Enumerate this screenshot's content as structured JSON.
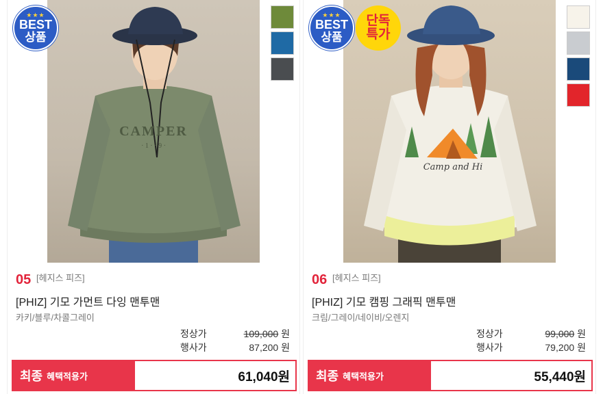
{
  "products": [
    {
      "badges": {
        "best_top": "BEST",
        "best_bottom": "상품",
        "stars": "★★★",
        "exclusive_top": "",
        "exclusive_bottom": ""
      },
      "swatches": [
        "#6e8a3a",
        "#1f6aa5",
        "#4a4d50"
      ],
      "rank": "05",
      "brand": "[헤지스 피즈]",
      "title": "[PHIZ] 기모 가먼트 다잉 맨투맨",
      "colors": "카키/블루/차콜그레이",
      "regular_label": "정상가",
      "regular_price": "109,000",
      "regular_unit": "원",
      "sale_label": "행사가",
      "sale_price": "87,200",
      "sale_unit": "원",
      "final_big": "최종",
      "final_small": "혜택적용가",
      "final_price": "61,040원",
      "photo": {
        "sweater": "#7c8a6c",
        "hat": "#2e3a52",
        "print": "CAMPER"
      }
    },
    {
      "badges": {
        "best_top": "BEST",
        "best_bottom": "상품",
        "stars": "★★★",
        "exclusive_top": "단독",
        "exclusive_bottom": "특가"
      },
      "swatches": [
        "#f7f3ea",
        "#c9ccd0",
        "#1a4a7a",
        "#e2252b"
      ],
      "rank": "06",
      "brand": "[헤지스 피즈]",
      "title": "[PHIZ] 기모 캠핑 그래픽 맨투맨",
      "colors": "크림/그레이/네이비/오렌지",
      "regular_label": "정상가",
      "regular_price": "99,000",
      "regular_unit": "원",
      "sale_label": "행사가",
      "sale_price": "79,200",
      "sale_unit": "원",
      "final_big": "최종",
      "final_small": "혜택적용가",
      "final_price": "55,440원",
      "photo": {
        "sweater": "#f2efe6",
        "hat": "#3a5a8a",
        "print": "Camp and Hi"
      }
    }
  ]
}
